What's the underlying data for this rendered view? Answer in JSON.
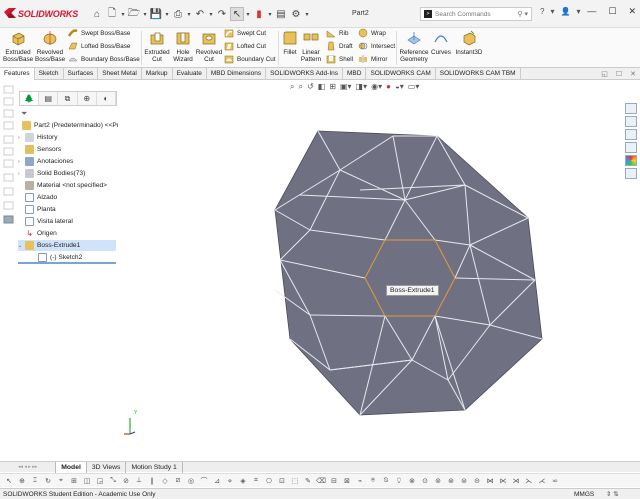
{
  "app": {
    "brand": "SOLIDWORKS",
    "doc_title": "Part2"
  },
  "search": {
    "placeholder": "Search Commands"
  },
  "ribbon": {
    "extruded_boss": "Extruded Boss/Base",
    "revolved_boss": "Revolved Boss/Base",
    "swept_boss": "Swept Boss/Base",
    "lofted_boss": "Lofted Boss/Base",
    "boundary_boss": "Boundary Boss/Base",
    "extruded_cut": "Extruded Cut",
    "hole_wizard": "Hole Wizard",
    "revolved_cut": "Revolved Cut",
    "swept_cut": "Swept Cut",
    "lofted_cut": "Lofted Cut",
    "boundary_cut": "Boundary Cut",
    "fillet": "Fillet",
    "linear_pattern": "Linear Pattern",
    "rib": "Rib",
    "draft": "Draft",
    "shell": "Shell",
    "wrap": "Wrap",
    "intersect": "Intersect",
    "mirror": "Mirror",
    "reference_geometry": "Reference Geometry",
    "curves": "Curves",
    "instant3d": "Instant3D"
  },
  "tabs": [
    "Features",
    "Sketch",
    "Surfaces",
    "Sheet Metal",
    "Markup",
    "Evaluate",
    "MBD Dimensions",
    "SOLIDWORKS Add-Ins",
    "MBD",
    "SOLIDWORKS CAM",
    "SOLIDWORKS CAM TBM"
  ],
  "tree": {
    "root": "Part2 (Predeterminado) <<Predeter",
    "items": [
      "History",
      "Sensors",
      "Anotaciones",
      "Solid Bodies(73)",
      "Material <not specified>",
      "Alzado",
      "Planta",
      "Visita lateral",
      "Origen",
      "Boss-Extrude1",
      "(-) Sketch2"
    ]
  },
  "viewport": {
    "tooltip": "Boss-Extrude1",
    "triad_y": "Y"
  },
  "bottom_tabs": [
    "Model",
    "3D Views",
    "Motion Study 1"
  ],
  "status": {
    "edition": "SOLIDWORKS Student Edition - Academic Use Only",
    "units": "MMGS"
  },
  "colors": {
    "part_fill": "#6f7183",
    "brand_red": "#d7172f",
    "selection_orange": "#e39a3c",
    "selected_row": "#cfe3fb"
  }
}
